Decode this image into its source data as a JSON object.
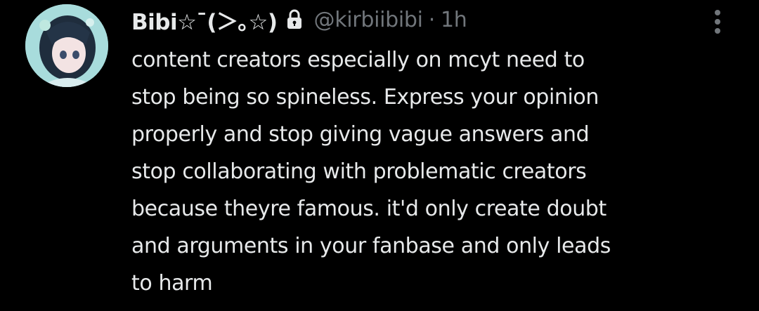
{
  "tweet": {
    "author": {
      "display_name": "Bibi☆¯(＞｡☆)",
      "handle": "@kirbiibibi",
      "avatar_icon": "anime-avatar-icon",
      "protected_icon": "lock-icon"
    },
    "separator": "·",
    "timestamp": "1h",
    "more_icon": "more-vertical-icon",
    "text": "content creators especially on mcyt need to\nstop being so spineless. Express your opinion\nproperly and stop giving vague answers and\nstop collaborating with problematic creators\nbecause theyre famous. it'd only create doubt\nand arguments in your fanbase and only leads\nto harm"
  },
  "colors": {
    "background": "#000000",
    "primary_text": "#e7e9ea",
    "secondary_text": "#71767b"
  }
}
